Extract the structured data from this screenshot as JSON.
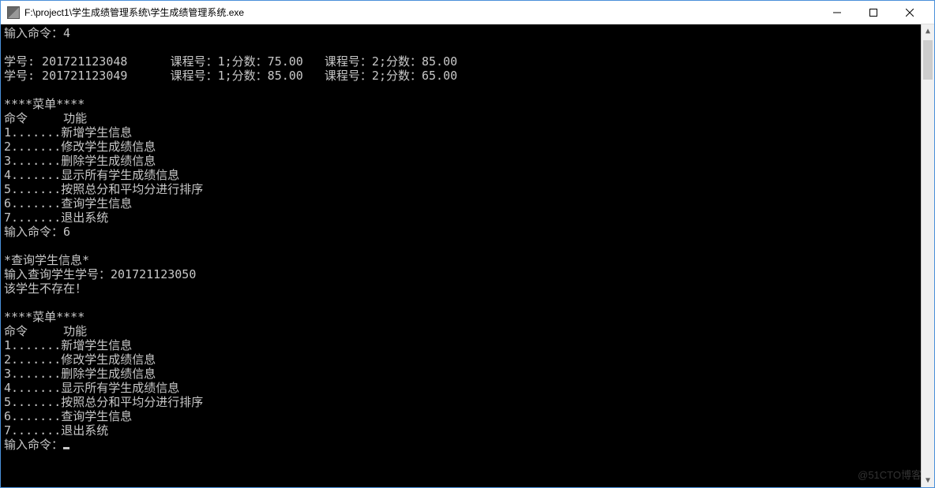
{
  "window": {
    "title": "F:\\project1\\学生成绩管理系统\\学生成绩管理系统.exe"
  },
  "console": {
    "prompt_cmd4": "输入命令：4",
    "blank": "",
    "result_row1": "学号: 201721123048      课程号：1;分数：75.00   课程号：2;分数：85.00",
    "result_row2": "学号: 201721123049      课程号：1;分数：85.00   课程号：2;分数：65.00",
    "menu_header": "****菜单****",
    "menu_cols": "命令     功能",
    "menu1": "1.......新增学生信息",
    "menu2": "2.......修改学生成绩信息",
    "menu3": "3.......删除学生成绩信息",
    "menu4": "4.......显示所有学生成绩信息",
    "menu5": "5.......按照总分和平均分进行排序",
    "menu6": "6.......查询学生信息",
    "menu7": "7.......退出系统",
    "prompt_cmd6": "输入命令：6",
    "query_header": "*查询学生信息*",
    "query_input": "输入查询学生学号：201721123050",
    "query_result": "该学生不存在！",
    "prompt_final": "输入命令："
  },
  "watermark": "@51CTO博客"
}
